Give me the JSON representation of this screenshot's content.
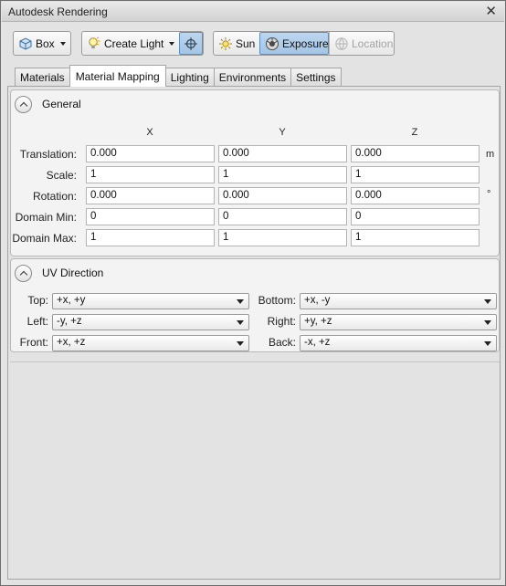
{
  "window": {
    "title": "Autodesk Rendering",
    "close_glyph": "✕"
  },
  "toolbar": {
    "box_label": "Box",
    "create_light_label": "Create Light",
    "sun_label": "Sun",
    "exposure_label": "Exposure",
    "location_label": "Location"
  },
  "tabs": [
    "Materials",
    "Material Mapping",
    "Lighting",
    "Environments",
    "Settings"
  ],
  "general": {
    "title": "General",
    "axes": [
      "X",
      "Y",
      "Z"
    ],
    "rows": [
      {
        "label": "Translation:",
        "values": [
          "0.000",
          "0.000",
          "0.000"
        ],
        "unit": "m"
      },
      {
        "label": "Scale:",
        "values": [
          "1",
          "1",
          "1"
        ],
        "unit": ""
      },
      {
        "label": "Rotation:",
        "values": [
          "0.000",
          "0.000",
          "0.000"
        ],
        "unit": "°"
      },
      {
        "label": "Domain Min:",
        "values": [
          "0",
          "0",
          "0"
        ],
        "unit": ""
      },
      {
        "label": "Domain Max:",
        "values": [
          "1",
          "1",
          "1"
        ],
        "unit": ""
      }
    ]
  },
  "uv": {
    "title": "UV Direction",
    "top": {
      "label": "Top:",
      "value": "+x, +y"
    },
    "bottom": {
      "label": "Bottom:",
      "value": "+x, -y"
    },
    "left": {
      "label": "Left:",
      "value": "-y, +z"
    },
    "right": {
      "label": "Right:",
      "value": "+y, +z"
    },
    "front": {
      "label": "Front:",
      "value": "+x, +z"
    },
    "back": {
      "label": "Back:",
      "value": "-x, +z"
    }
  },
  "icons": {
    "box": "box-icon",
    "create_light": "light-bulb-icon",
    "target": "target-icon",
    "sun": "sun-icon",
    "exposure": "exposure-icon",
    "location": "globe-icon"
  },
  "colors": {
    "pressed_bg": "#a5c5e6",
    "pressed_border": "#5a8fc3"
  }
}
